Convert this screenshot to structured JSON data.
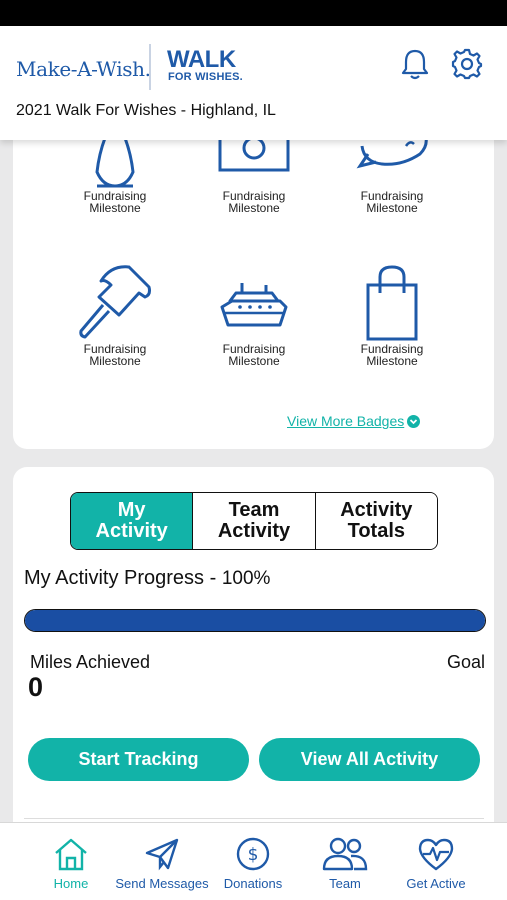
{
  "header": {
    "brand": "Make-A-Wish.",
    "walk_title": "WALK",
    "walk_subtitle": "FOR WISHES.",
    "event_title": "2021 Walk For Wishes - Highland, IL",
    "icons": [
      "bell-icon",
      "gear-icon"
    ]
  },
  "badges": {
    "items": [
      {
        "label_line1": "Fundraising",
        "label_line2": "Milestone",
        "icon": "dress-icon"
      },
      {
        "label_line1": "Fundraising",
        "label_line2": "Milestone",
        "icon": "camera-icon"
      },
      {
        "label_line1": "Fundraising",
        "label_line2": "Milestone",
        "icon": "speech-bubble-icon"
      },
      {
        "label_line1": "Fundraising",
        "label_line2": "Milestone",
        "icon": "hammer-icon"
      },
      {
        "label_line1": "Fundraising",
        "label_line2": "Milestone",
        "icon": "cruise-ship-icon"
      },
      {
        "label_line1": "Fundraising",
        "label_line2": "Milestone",
        "icon": "shopping-bag-icon"
      }
    ],
    "view_more": "View More Badges"
  },
  "activity": {
    "tabs": [
      {
        "line1": "My",
        "line2": "Activity",
        "active": true
      },
      {
        "line1": "Team",
        "line2": "Activity",
        "active": false
      },
      {
        "line1": "Activity",
        "line2": "Totals",
        "active": false
      }
    ],
    "progress_label": "My Activity Progress -",
    "progress_percent_text": "100%",
    "progress_fraction": 1.0,
    "miles_label": "Miles Achieved",
    "miles_value": "0",
    "goal_label": "Goal",
    "start_button": "Start Tracking",
    "view_all_button": "View All Activity"
  },
  "nav": {
    "items": [
      {
        "label": "Home",
        "icon": "home-icon",
        "active": true
      },
      {
        "label": "Send Messages",
        "icon": "paper-plane-icon",
        "active": false
      },
      {
        "label": "Donations",
        "icon": "dollar-icon",
        "active": false
      },
      {
        "label": "Team",
        "icon": "team-icon",
        "active": false
      },
      {
        "label": "Get Active",
        "icon": "heartbeat-icon",
        "active": false
      }
    ]
  },
  "colors": {
    "teal": "#12b3a8",
    "brand_blue": "#1f5aa8",
    "progress_blue": "#1a4ea3"
  }
}
